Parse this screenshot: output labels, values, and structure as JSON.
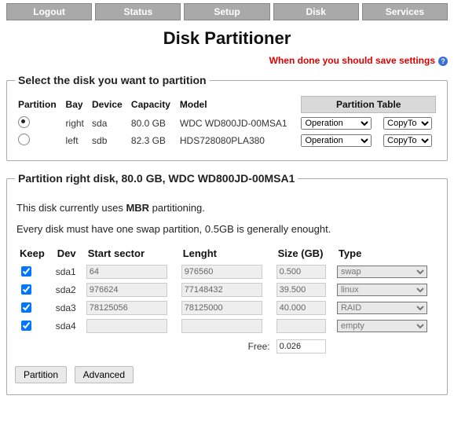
{
  "nav": [
    "Logout",
    "Status",
    "Setup",
    "Disk",
    "Services"
  ],
  "title": "Disk Partitioner",
  "warning": "When done you should save settings",
  "select_box": {
    "legend": "Select the disk you want to partition",
    "headers": [
      "Partition",
      "Bay",
      "Device",
      "Capacity",
      "Model"
    ],
    "pt_header": "Partition Table",
    "op_label": "Operation",
    "cp_label": "CopyTo",
    "rows": [
      {
        "bay": "right",
        "dev": "sda",
        "cap": "80.0 GB",
        "model": "WDC WD800JD-00MSA1",
        "sel": true
      },
      {
        "bay": "left",
        "dev": "sdb",
        "cap": "82.3 GB",
        "model": "HDS728080PLA380",
        "sel": false
      }
    ]
  },
  "part_box": {
    "legend": "Partition right disk, 80.0 GB, WDC WD800JD-00MSA1",
    "info1_a": "This disk currently uses ",
    "info1_b": "MBR",
    "info1_c": " partitioning.",
    "info2": "Every disk must have one swap partition, 0.5GB is generally enought.",
    "headers": {
      "keep": "Keep",
      "dev": "Dev",
      "start": "Start sector",
      "len": "Lenght",
      "size": "Size (GB)",
      "type": "Type"
    },
    "rows": [
      {
        "dev": "sda1",
        "start": "64",
        "len": "976560",
        "size": "0.500",
        "type": "swap"
      },
      {
        "dev": "sda2",
        "start": "976624",
        "len": "77148432",
        "size": "39.500",
        "type": "linux"
      },
      {
        "dev": "sda3",
        "start": "78125056",
        "len": "78125000",
        "size": "40.000",
        "type": "RAID"
      },
      {
        "dev": "sda4",
        "start": "",
        "len": "",
        "size": "",
        "type": "empty"
      }
    ],
    "free_label": "Free:",
    "free_value": "0.026",
    "buttons": {
      "partition": "Partition",
      "advanced": "Advanced"
    }
  }
}
